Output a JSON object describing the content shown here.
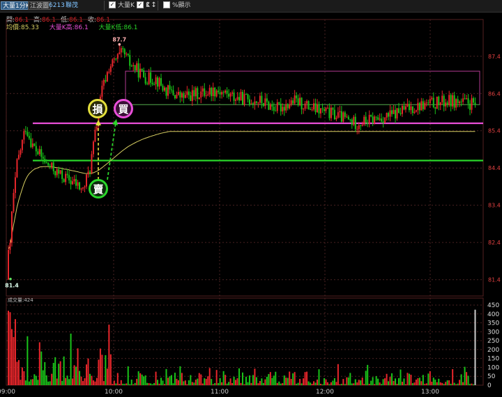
{
  "toolbar": {
    "period_button": "大量1分K",
    "chart_button": "江波圖",
    "stock_code": "6213",
    "stock_name": "聯茂",
    "option_big_k": "大量K",
    "option_k": "K",
    "option_percent": "%顯示"
  },
  "info": {
    "open_label": "開:",
    "open_value": "86.1",
    "high_label": "高:",
    "high_value": "86.1",
    "low_label": "低:",
    "low_value": "86.1",
    "close_label": "收:",
    "close_value": "86.1",
    "avg_label": "均價:",
    "avg_value": "85.33",
    "big_high_label": "大量K高:",
    "big_high_value": "86.1",
    "big_low_label": "大量K低:",
    "big_low_value": "86.1"
  },
  "volume_panel": {
    "label": "成交量:424"
  },
  "annotations": {
    "high_price": "87.7",
    "low_price": "81.4",
    "stop_label": "損",
    "buy_label": "買",
    "sell_label": "賣"
  },
  "colors": {
    "up": "#e8262b",
    "down": "#19c319",
    "magenta": "#e94fd9",
    "green_line": "#2ad62a",
    "avg_line": "#d8cf62",
    "grid": "#4a2222"
  },
  "chart_data": {
    "type": "candlestick",
    "price_axis": {
      "ticks": [
        81.4,
        82.4,
        83.4,
        84.4,
        85.4,
        86.4,
        87.4
      ],
      "ylim": [
        81.0,
        88.2
      ]
    },
    "volume_axis": {
      "ticks": [
        0,
        50,
        100,
        150,
        200,
        250,
        300,
        350,
        400,
        450
      ],
      "ylim": [
        0,
        450
      ]
    },
    "time_axis": {
      "labels": [
        "09:00",
        "10:00",
        "11:00",
        "12:00",
        "13:00"
      ]
    },
    "session_high": 87.7,
    "session_low": 81.4,
    "avg_price": 85.33,
    "big_k_high": 85.6,
    "big_k_low": 84.6,
    "last_volume": 424
  }
}
